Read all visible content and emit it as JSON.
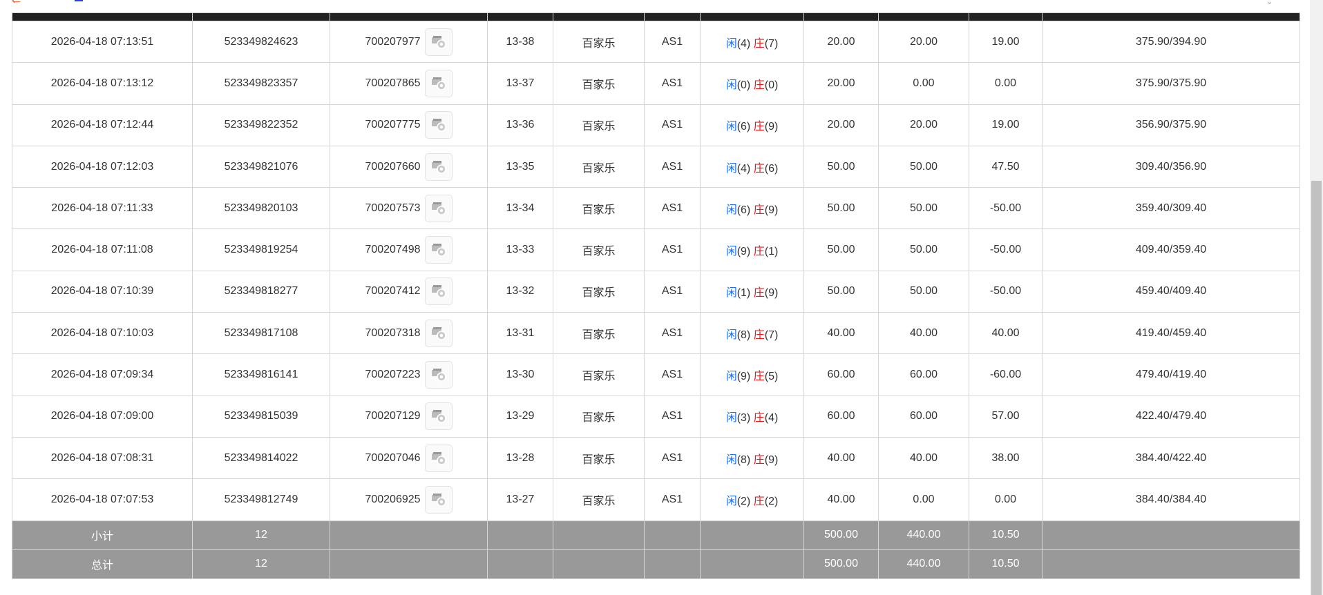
{
  "rows": [
    {
      "time": "2026-04-18 07:13:51",
      "bet_id": "523349824623",
      "game_id": "700207977",
      "round": "13-38",
      "game": "百家乐",
      "table": "AS1",
      "result": {
        "xian_label": "闲",
        "xian_val": "(4)",
        "zhuang_label": "庄",
        "zhuang_val": "(7)"
      },
      "bet": "20.00",
      "valid": "20.00",
      "win": "19.00",
      "win_neg": false,
      "balance": "375.90/394.90"
    },
    {
      "time": "2026-04-18 07:13:12",
      "bet_id": "523349823357",
      "game_id": "700207865",
      "round": "13-37",
      "game": "百家乐",
      "table": "AS1",
      "result": {
        "xian_label": "闲",
        "xian_val": "(0)",
        "zhuang_label": "庄",
        "zhuang_val": "(0)"
      },
      "bet": "20.00",
      "valid": "0.00",
      "win": "0.00",
      "win_neg": false,
      "balance": "375.90/375.90"
    },
    {
      "time": "2026-04-18 07:12:44",
      "bet_id": "523349822352",
      "game_id": "700207775",
      "round": "13-36",
      "game": "百家乐",
      "table": "AS1",
      "result": {
        "xian_label": "闲",
        "xian_val": "(6)",
        "zhuang_label": "庄",
        "zhuang_val": "(9)"
      },
      "bet": "20.00",
      "valid": "20.00",
      "win": "19.00",
      "win_neg": false,
      "balance": "356.90/375.90"
    },
    {
      "time": "2026-04-18 07:12:03",
      "bet_id": "523349821076",
      "game_id": "700207660",
      "round": "13-35",
      "game": "百家乐",
      "table": "AS1",
      "result": {
        "xian_label": "闲",
        "xian_val": "(4)",
        "zhuang_label": "庄",
        "zhuang_val": "(6)"
      },
      "bet": "50.00",
      "valid": "50.00",
      "win": "47.50",
      "win_neg": false,
      "balance": "309.40/356.90"
    },
    {
      "time": "2026-04-18 07:11:33",
      "bet_id": "523349820103",
      "game_id": "700207573",
      "round": "13-34",
      "game": "百家乐",
      "table": "AS1",
      "result": {
        "xian_label": "闲",
        "xian_val": "(6)",
        "zhuang_label": "庄",
        "zhuang_val": "(9)"
      },
      "bet": "50.00",
      "valid": "50.00",
      "win": "-50.00",
      "win_neg": true,
      "balance": "359.40/309.40"
    },
    {
      "time": "2026-04-18 07:11:08",
      "bet_id": "523349819254",
      "game_id": "700207498",
      "round": "13-33",
      "game": "百家乐",
      "table": "AS1",
      "result": {
        "xian_label": "闲",
        "xian_val": "(9)",
        "zhuang_label": "庄",
        "zhuang_val": "(1)"
      },
      "bet": "50.00",
      "valid": "50.00",
      "win": "-50.00",
      "win_neg": true,
      "balance": "409.40/359.40"
    },
    {
      "time": "2026-04-18 07:10:39",
      "bet_id": "523349818277",
      "game_id": "700207412",
      "round": "13-32",
      "game": "百家乐",
      "table": "AS1",
      "result": {
        "xian_label": "闲",
        "xian_val": "(1)",
        "zhuang_label": "庄",
        "zhuang_val": "(9)"
      },
      "bet": "50.00",
      "valid": "50.00",
      "win": "-50.00",
      "win_neg": true,
      "balance": "459.40/409.40"
    },
    {
      "time": "2026-04-18 07:10:03",
      "bet_id": "523349817108",
      "game_id": "700207318",
      "round": "13-31",
      "game": "百家乐",
      "table": "AS1",
      "result": {
        "xian_label": "闲",
        "xian_val": "(8)",
        "zhuang_label": "庄",
        "zhuang_val": "(7)"
      },
      "bet": "40.00",
      "valid": "40.00",
      "win": "40.00",
      "win_neg": false,
      "balance": "419.40/459.40"
    },
    {
      "time": "2026-04-18 07:09:34",
      "bet_id": "523349816141",
      "game_id": "700207223",
      "round": "13-30",
      "game": "百家乐",
      "table": "AS1",
      "result": {
        "xian_label": "闲",
        "xian_val": "(9)",
        "zhuang_label": "庄",
        "zhuang_val": "(5)"
      },
      "bet": "60.00",
      "valid": "60.00",
      "win": "-60.00",
      "win_neg": true,
      "balance": "479.40/419.40"
    },
    {
      "time": "2026-04-18 07:09:00",
      "bet_id": "523349815039",
      "game_id": "700207129",
      "round": "13-29",
      "game": "百家乐",
      "table": "AS1",
      "result": {
        "xian_label": "闲",
        "xian_val": "(3)",
        "zhuang_label": "庄",
        "zhuang_val": "(4)"
      },
      "bet": "60.00",
      "valid": "60.00",
      "win": "57.00",
      "win_neg": false,
      "balance": "422.40/479.40"
    },
    {
      "time": "2026-04-18 07:08:31",
      "bet_id": "523349814022",
      "game_id": "700207046",
      "round": "13-28",
      "game": "百家乐",
      "table": "AS1",
      "result": {
        "xian_label": "闲",
        "xian_val": "(8)",
        "zhuang_label": "庄",
        "zhuang_val": "(9)"
      },
      "bet": "40.00",
      "valid": "40.00",
      "win": "38.00",
      "win_neg": false,
      "balance": "384.40/422.40"
    },
    {
      "time": "2026-04-18 07:07:53",
      "bet_id": "523349812749",
      "game_id": "700206925",
      "round": "13-27",
      "game": "百家乐",
      "table": "AS1",
      "result": {
        "xian_label": "闲",
        "xian_val": "(2)",
        "zhuang_label": "庄",
        "zhuang_val": "(2)"
      },
      "bet": "40.00",
      "valid": "0.00",
      "win": "0.00",
      "win_neg": false,
      "balance": "384.40/384.40"
    }
  ],
  "subtotal": {
    "label": "小计",
    "count": "12",
    "bet": "500.00",
    "valid": "440.00",
    "win": "10.50"
  },
  "total": {
    "label": "总计",
    "count": "12",
    "bet": "500.00",
    "valid": "440.00",
    "win": "10.50"
  },
  "colors": {
    "header_bg": "#222222",
    "summary_bg": "#999999",
    "blue": "#1f6fe6",
    "red": "#e31b1b",
    "back_arrow": "#e8602c"
  },
  "icons": {
    "back": "back-arrow-icon",
    "game_result": "roulette-chip-icon"
  }
}
